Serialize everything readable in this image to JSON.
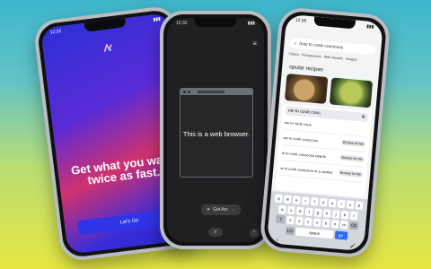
{
  "colors": {
    "accent_blue": "#2f35e6",
    "google_blue": "#2a6df4",
    "dark_browser": "#1f2021"
  },
  "phone1": {
    "time": "12:32",
    "headline": "Get what you want twice as fast.",
    "cta_label": "Let's Go",
    "logo_icon": "arc-logo-icon"
  },
  "phone2": {
    "time": "12:32",
    "window_text": "This is a web browser.",
    "get_arc_label": "Get Arc",
    "menu_icon": "menu-icon"
  },
  "phone3": {
    "time": "12:36",
    "search_query": "how to cook couscous",
    "tabs": [
      "Videos",
      "Perspectives",
      "Web Results",
      "Images"
    ],
    "section_title": "opular recipes",
    "suggest_input": "ow to cook cous",
    "suggestions": [
      {
        "text": "ow to cook cous",
        "button": ""
      },
      {
        "text": "ow to cook couscous",
        "button": "Browse for Me"
      },
      {
        "text": "w to cook couscous pearls",
        "button": "Browse for Me"
      },
      {
        "text": "w to cook couscous in a cooker",
        "button": "Browse for Me"
      }
    ],
    "keyboard_rows": [
      [
        "q",
        "w",
        "e",
        "r",
        "t",
        "y",
        "u",
        "i",
        "o",
        "p"
      ],
      [
        "a",
        "s",
        "d",
        "f",
        "g",
        "h",
        "j",
        "k",
        "l"
      ],
      [
        "⇧",
        "z",
        "x",
        "c",
        "v",
        "b",
        "n",
        "m",
        "⌫"
      ]
    ],
    "space_label": "space",
    "go_label": "go",
    "num_label": "123"
  }
}
